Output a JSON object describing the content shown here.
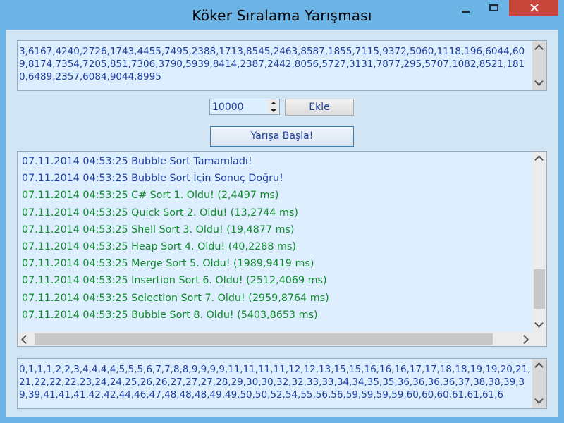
{
  "window": {
    "title": "Köker Sıralama Yarışması"
  },
  "input_numbers": {
    "text": "3,6167,4240,2726,1743,4455,7495,2388,1713,8545,2463,8587,1855,7115,9372,5060,1118,196,6044,609,8174,7354,7205,851,7306,3790,5939,8414,2387,2442,8056,5727,3131,7877,295,5707,1082,8521,1810,6489,2357,6084,9044,8995"
  },
  "controls": {
    "count_value": "10000",
    "add_label": "Ekle",
    "start_label": "Yarışa Başla!"
  },
  "log": {
    "lines": [
      {
        "text": "07.11.2014 04:53:25 Bubble Sort Tamamladı!",
        "color": "blue"
      },
      {
        "text": "07.11.2014 04:53:25 Bubble Sort İçin Sonuç Doğru!",
        "color": "blue"
      },
      {
        "text": "07.11.2014 04:53:25 C# Sort 1. Oldu! (2,4497 ms)",
        "color": "green"
      },
      {
        "text": "07.11.2014 04:53:25 Quick Sort 2. Oldu! (13,2744 ms)",
        "color": "green"
      },
      {
        "text": "07.11.2014 04:53:25 Shell Sort 3. Oldu! (19,4877 ms)",
        "color": "green"
      },
      {
        "text": "07.11.2014 04:53:25 Heap Sort 4. Oldu! (40,2288 ms)",
        "color": "green"
      },
      {
        "text": "07.11.2014 04:53:25 Merge Sort 5. Oldu! (1989,9419 ms)",
        "color": "green"
      },
      {
        "text": "07.11.2014 04:53:25 Insertion Sort 6. Oldu! (2512,4069 ms)",
        "color": "green"
      },
      {
        "text": "07.11.2014 04:53:25 Selection Sort 7. Oldu! (2959,8764 ms)",
        "color": "green"
      },
      {
        "text": "07.11.2014 04:53:25 Bubble Sort 8. Oldu! (5403,8653 ms)",
        "color": "green"
      }
    ]
  },
  "output_numbers": {
    "text": "0,1,1,1,2,2,3,4,4,4,4,5,5,5,6,7,7,8,8,9,9,9,9,11,11,11,11,12,12,13,15,15,16,16,16,17,17,18,18,19,19,20,21,21,22,22,22,23,24,24,25,26,26,27,27,27,28,29,30,30,32,32,33,33,34,34,35,35,36,36,36,36,37,38,38,39,39,39,41,41,41,42,42,44,46,47,48,48,48,49,49,50,50,52,54,55,56,56,59,59,59,59,60,60,60,61,61,61,6"
  }
}
